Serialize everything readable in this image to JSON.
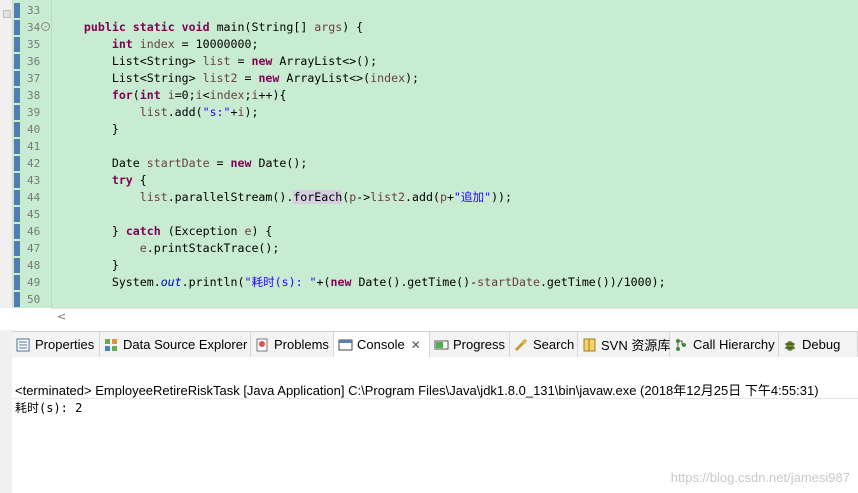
{
  "editor": {
    "lines": [
      {
        "num": "33",
        "tokens": []
      },
      {
        "num": "34",
        "fold": "-",
        "tokens": [
          [
            "t",
            "    "
          ],
          [
            "kw",
            "public"
          ],
          [
            "t",
            " "
          ],
          [
            "kw",
            "static"
          ],
          [
            "t",
            " "
          ],
          [
            "kw",
            "void"
          ],
          [
            "t",
            " main(String[] "
          ],
          [
            "var",
            "args"
          ],
          [
            "t",
            ") {"
          ]
        ]
      },
      {
        "num": "35",
        "tokens": [
          [
            "t",
            "        "
          ],
          [
            "kw",
            "int"
          ],
          [
            "t",
            " "
          ],
          [
            "var",
            "index"
          ],
          [
            "t",
            " = 10000000;"
          ]
        ]
      },
      {
        "num": "36",
        "tokens": [
          [
            "t",
            "        List<String> "
          ],
          [
            "var",
            "list"
          ],
          [
            "t",
            " = "
          ],
          [
            "kw",
            "new"
          ],
          [
            "t",
            " ArrayList<>();"
          ]
        ]
      },
      {
        "num": "37",
        "tokens": [
          [
            "t",
            "        List<String> "
          ],
          [
            "var",
            "list2"
          ],
          [
            "t",
            " = "
          ],
          [
            "kw",
            "new"
          ],
          [
            "t",
            " ArrayList<>("
          ],
          [
            "var",
            "index"
          ],
          [
            "t",
            ");"
          ]
        ]
      },
      {
        "num": "38",
        "tokens": [
          [
            "t",
            "        "
          ],
          [
            "kw",
            "for"
          ],
          [
            "t",
            "("
          ],
          [
            "kw",
            "int"
          ],
          [
            "t",
            " "
          ],
          [
            "var",
            "i"
          ],
          [
            "t",
            "=0;"
          ],
          [
            "var",
            "i"
          ],
          [
            "t",
            "<"
          ],
          [
            "var",
            "index"
          ],
          [
            "t",
            ";"
          ],
          [
            "var",
            "i"
          ],
          [
            "t",
            "++){"
          ]
        ]
      },
      {
        "num": "39",
        "tokens": [
          [
            "t",
            "            "
          ],
          [
            "var",
            "list"
          ],
          [
            "t",
            ".add("
          ],
          [
            "str",
            "\"s:\""
          ],
          [
            "t",
            "+"
          ],
          [
            "var",
            "i"
          ],
          [
            "t",
            ");"
          ]
        ]
      },
      {
        "num": "40",
        "tokens": [
          [
            "t",
            "        }"
          ]
        ]
      },
      {
        "num": "41",
        "tokens": []
      },
      {
        "num": "42",
        "tokens": [
          [
            "t",
            "        Date "
          ],
          [
            "var",
            "startDate"
          ],
          [
            "t",
            " = "
          ],
          [
            "kw",
            "new"
          ],
          [
            "t",
            " Date();"
          ]
        ]
      },
      {
        "num": "43",
        "tokens": [
          [
            "t",
            "        "
          ],
          [
            "kw",
            "try"
          ],
          [
            "t",
            " {"
          ]
        ]
      },
      {
        "num": "44",
        "tokens": [
          [
            "t",
            "            "
          ],
          [
            "var",
            "list"
          ],
          [
            "t",
            ".parallelStream()."
          ],
          [
            "hl",
            "forEach"
          ],
          [
            "t",
            "("
          ],
          [
            "var",
            "p"
          ],
          [
            "t",
            "->"
          ],
          [
            "var",
            "list2"
          ],
          [
            "t",
            ".add("
          ],
          [
            "var",
            "p"
          ],
          [
            "t",
            "+"
          ],
          [
            "str",
            "\"追加\""
          ],
          [
            "t",
            "));"
          ]
        ]
      },
      {
        "num": "45",
        "tokens": []
      },
      {
        "num": "46",
        "tokens": [
          [
            "t",
            "        } "
          ],
          [
            "kw",
            "catch"
          ],
          [
            "t",
            " (Exception "
          ],
          [
            "var",
            "e"
          ],
          [
            "t",
            ") {"
          ]
        ]
      },
      {
        "num": "47",
        "tokens": [
          [
            "t",
            "            "
          ],
          [
            "var",
            "e"
          ],
          [
            "t",
            ".printStackTrace();"
          ]
        ]
      },
      {
        "num": "48",
        "tokens": [
          [
            "t",
            "        }"
          ]
        ]
      },
      {
        "num": "49",
        "tokens": [
          [
            "t",
            "        System."
          ],
          [
            "fld",
            "out"
          ],
          [
            "t",
            ".println("
          ],
          [
            "str",
            "\"耗时(s): \""
          ],
          [
            "t",
            "+("
          ],
          [
            "kw",
            "new"
          ],
          [
            "t",
            " Date().getTime()-"
          ],
          [
            "var",
            "startDate"
          ],
          [
            "t",
            ".getTime())/1000);"
          ]
        ]
      },
      {
        "num": "50",
        "tokens": []
      }
    ]
  },
  "tabs": [
    {
      "label": "Properties",
      "icon": "properties-icon"
    },
    {
      "label": "Data Source Explorer",
      "icon": "data-source-icon"
    },
    {
      "label": "Problems",
      "icon": "problems-icon"
    },
    {
      "label": "Console",
      "icon": "console-icon",
      "active": true,
      "close": "✕"
    },
    {
      "label": "Progress",
      "icon": "progress-icon"
    },
    {
      "label": "Search",
      "icon": "search-icon"
    },
    {
      "label": "SVN 资源库",
      "icon": "svn-icon"
    },
    {
      "label": "Call Hierarchy",
      "icon": "call-hierarchy-icon"
    },
    {
      "label": "Debug",
      "icon": "debug-icon"
    }
  ],
  "console": {
    "terminated": "<terminated> EmployeeRetireRiskTask [Java Application] C:\\Program Files\\Java\\jdk1.8.0_131\\bin\\javaw.exe (2018年12月25日 下午4:55:31)",
    "output": "耗时(s): 2"
  },
  "watermark": "https://blog.csdn.net/jamesi987",
  "colors": {
    "editor_bg": "#c8ecd2",
    "keyword": "#7f0055",
    "string": "#2a00ff",
    "field": "#0000c0"
  }
}
